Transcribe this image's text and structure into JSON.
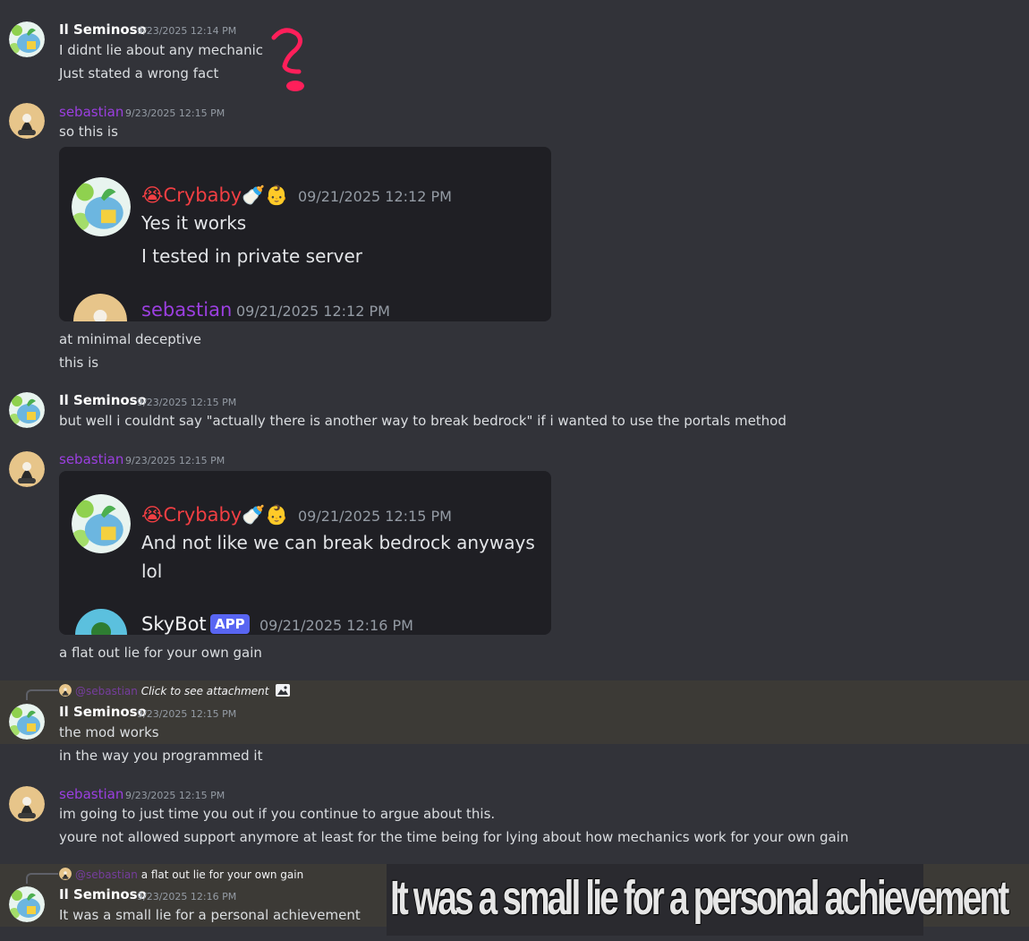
{
  "annotation": {
    "color": "#ff1f5a"
  },
  "messages": {
    "m1": {
      "user": "Il Seminoso",
      "ts": "9/23/2025 12:14 PM",
      "lines": [
        "I didnt lie about any mechanic",
        "Just stated a wrong fact"
      ]
    },
    "m2": {
      "user": "sebastian",
      "ts": "9/23/2025 12:15 PM",
      "lines": [
        "so this is"
      ],
      "embed": {
        "user": "😭Crybaby🍼👶",
        "ts": "09/21/2025 12:12 PM",
        "lines": [
          "Yes it works",
          "I tested in private server"
        ],
        "next_user": "sebastian",
        "next_ts": "09/21/2025 12:12 PM"
      },
      "after": [
        "at minimal deceptive",
        "this is"
      ]
    },
    "m3": {
      "user": "Il Seminoso",
      "ts": "9/23/2025 12:15 PM",
      "lines": [
        "but well i couldnt say \"actually there is another way to break bedrock\" if i wanted to use the portals method"
      ]
    },
    "m4": {
      "user": "sebastian",
      "ts": "9/23/2025 12:15 PM",
      "embed": {
        "user": "😭Crybaby🍼👶",
        "ts": "09/21/2025 12:15 PM",
        "lines": [
          "And not like we can break bedrock anyways",
          "lol"
        ],
        "next_user": "SkyBot",
        "next_badge": "APP",
        "next_ts": "09/21/2025 12:16 PM"
      },
      "after": [
        "a flat out lie for your own gain"
      ]
    },
    "m5": {
      "reply_mention": "@sebastian",
      "reply_text": "Click to see attachment",
      "user": "Il Seminoso",
      "ts": "9/23/2025 12:15 PM",
      "lines": [
        "the mod works",
        "in the way you programmed it"
      ]
    },
    "m6": {
      "user": "sebastian",
      "ts": "9/23/2025 12:15 PM",
      "lines": [
        "im going to just time you out if you continue to argue about this.",
        "youre not allowed support anymore at least for the time being for lying about how mechanics work for your own gain"
      ]
    },
    "m7": {
      "reply_mention": "@sebastian",
      "reply_text": "a flat out lie for your own gain",
      "user": "Il Seminoso",
      "ts": "9/23/2025 12:16 PM",
      "lines": [
        "It was a small lie for a personal achievement"
      ]
    }
  },
  "meme": {
    "text": "It was a small lie for a personal achievement"
  }
}
